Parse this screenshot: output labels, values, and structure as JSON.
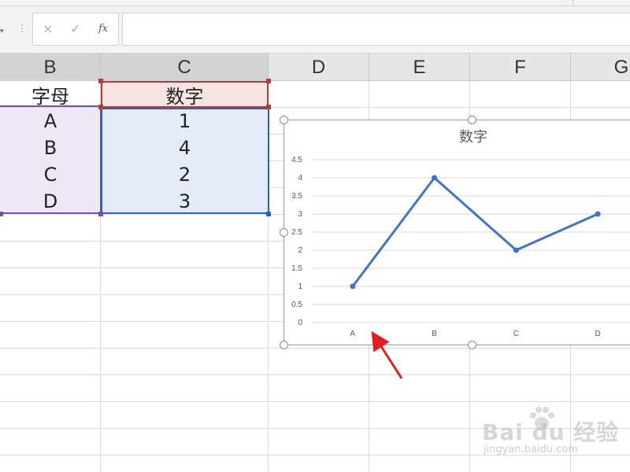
{
  "ribbon": {
    "group_label": ""
  },
  "formula_bar": {
    "cancel_icon": "×",
    "confirm_icon": "✓",
    "fx_label": "fx",
    "formula_value": ""
  },
  "columns": [
    {
      "label": "B"
    },
    {
      "label": "C"
    },
    {
      "label": "D"
    },
    {
      "label": "E"
    },
    {
      "label": "F"
    },
    {
      "label": "G"
    }
  ],
  "table": {
    "header_b": "字母",
    "header_c": "数字",
    "rows": [
      {
        "letter": "A",
        "number": "1"
      },
      {
        "letter": "B",
        "number": "4"
      },
      {
        "letter": "C",
        "number": "2"
      },
      {
        "letter": "D",
        "number": "3"
      }
    ]
  },
  "colors": {
    "series_line": "#4472c4",
    "header_range": "#b13c3c",
    "category_range": "#7a4fa0",
    "value_range": "#2f5fb8",
    "annotation_arrow": "#e02020"
  },
  "chart_data": {
    "type": "line",
    "title": "数字",
    "categories": [
      "A",
      "B",
      "C",
      "D"
    ],
    "series": [
      {
        "name": "数字",
        "values": [
          1,
          4,
          2,
          3
        ]
      }
    ],
    "ylim": [
      0,
      4.5
    ],
    "yticks": [
      "0",
      "0.5",
      "1",
      "1.5",
      "2",
      "2.5",
      "3",
      "3.5",
      "4",
      "4.5"
    ],
    "grid": true,
    "legend": "none"
  },
  "watermark": {
    "main": "Bai du 经验",
    "sub": "jingyan.baidu.com"
  }
}
